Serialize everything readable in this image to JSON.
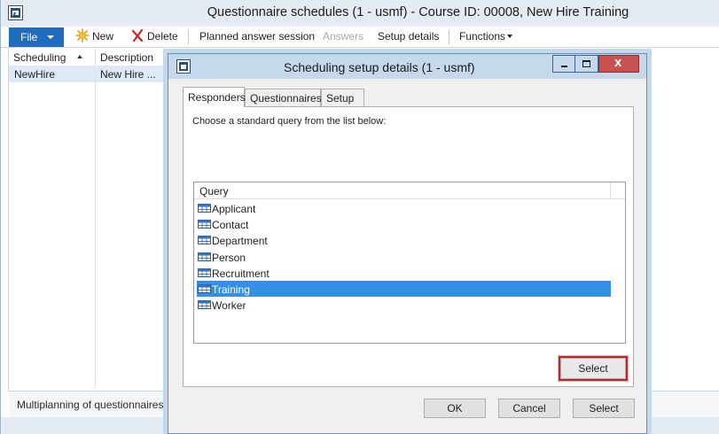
{
  "main_window": {
    "title": "Questionnaire schedules (1 - usmf) - Course ID: 00008, New Hire Training"
  },
  "ribbon": {
    "file": "File",
    "new": "New",
    "delete": "Delete",
    "planned_answer_session": "Planned answer session",
    "answers": "Answers",
    "setup_details": "Setup details",
    "functions": "Functions"
  },
  "grid": {
    "columns": [
      "Scheduling",
      "Description"
    ],
    "rows": [
      {
        "scheduling": "NewHire",
        "description": "New Hire ..."
      }
    ]
  },
  "status": {
    "text": "Multiplanning of questionnaires"
  },
  "dialog": {
    "title": "Scheduling setup details (1 - usmf)",
    "tabs": [
      "Responders",
      "Questionnaires",
      "Setup"
    ],
    "active_tab": "Responders",
    "instruction": "Choose a standard query from the list below:",
    "list_header": "Query",
    "queries": [
      "Applicant",
      "Contact",
      "Department",
      "Person",
      "Recruitment",
      "Training",
      "Worker"
    ],
    "selected_query": "Training",
    "select_inner": "Select",
    "ok": "OK",
    "cancel": "Cancel",
    "select": "Select"
  },
  "colors": {
    "file_button": "#1f6cc0",
    "selection": "#3390e6",
    "close_button": "#c75050",
    "highlight_outline": "#b82a2a",
    "dialog_frame": "#c5d8ec"
  }
}
